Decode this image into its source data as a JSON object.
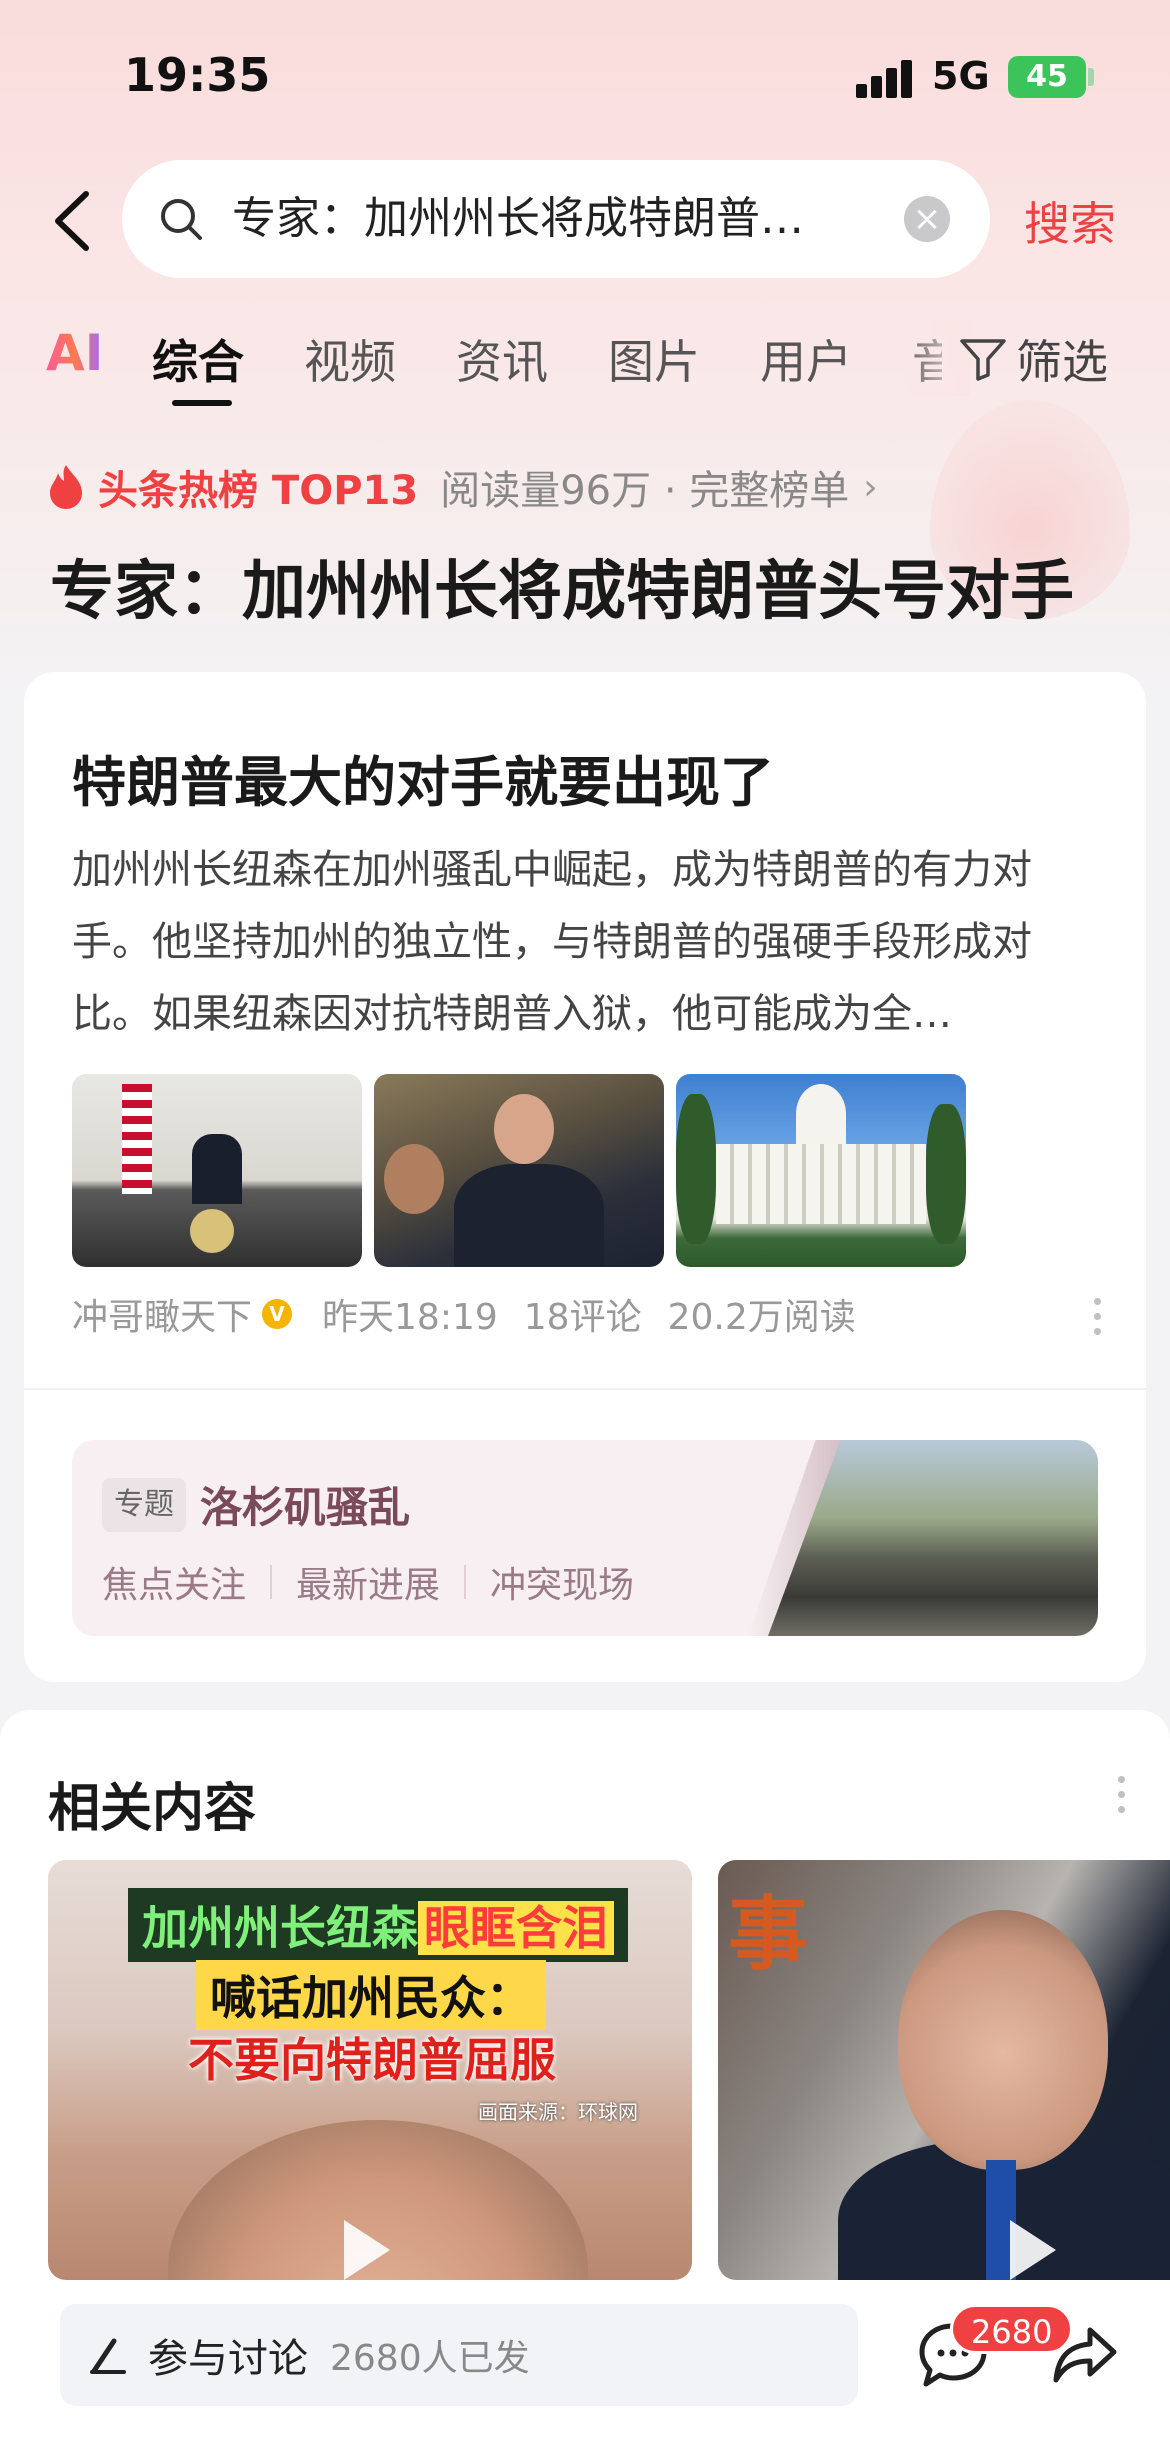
{
  "status": {
    "time": "19:35",
    "network": "5G",
    "battery": "45"
  },
  "search": {
    "query": "专家：加州州长将成特朗普…",
    "submit": "搜索"
  },
  "tabs": {
    "ai": "AI",
    "items": [
      "综合",
      "视频",
      "资讯",
      "图片",
      "用户",
      "音"
    ],
    "filter": "筛选"
  },
  "hot": {
    "label": "头条热榜 TOP13",
    "meta": "阅读量96万 · 完整榜单",
    "headline": "专家：加州州长将成特朗普头号对手"
  },
  "article": {
    "title": "特朗普最大的对手就要出现了",
    "body": "加州州长纽森在加州骚乱中崛起，成为特朗普的有力对手。他坚持加州的独立性，与特朗普的强硬手段形成对比。如果纽森因对抗特朗普入狱，他可能成为全…",
    "author": "冲哥瞰天下",
    "time": "昨天18:19",
    "comments": "18评论",
    "reads": "20.2万阅读"
  },
  "topic": {
    "tag": "专题",
    "title": "洛杉矶骚乱",
    "links": [
      "焦点关注",
      "最新进展",
      "冲突现场"
    ]
  },
  "related": {
    "title": "相关内容",
    "video1": {
      "line1_a": "加州州长纽森",
      "line1_b": "眼眶含泪",
      "line2": "喊话加州民众：",
      "line3": "不要向特朗普屈服",
      "source": "画面来源：环球网"
    },
    "video2": {
      "char": "事"
    }
  },
  "bottom": {
    "discuss_label": "参与讨论",
    "discuss_count": "2680人已发",
    "comment_badge": "2680"
  },
  "colors": {
    "accent": "#f04142",
    "topic_title": "#7a4a5a",
    "battery": "#3cc45a"
  }
}
